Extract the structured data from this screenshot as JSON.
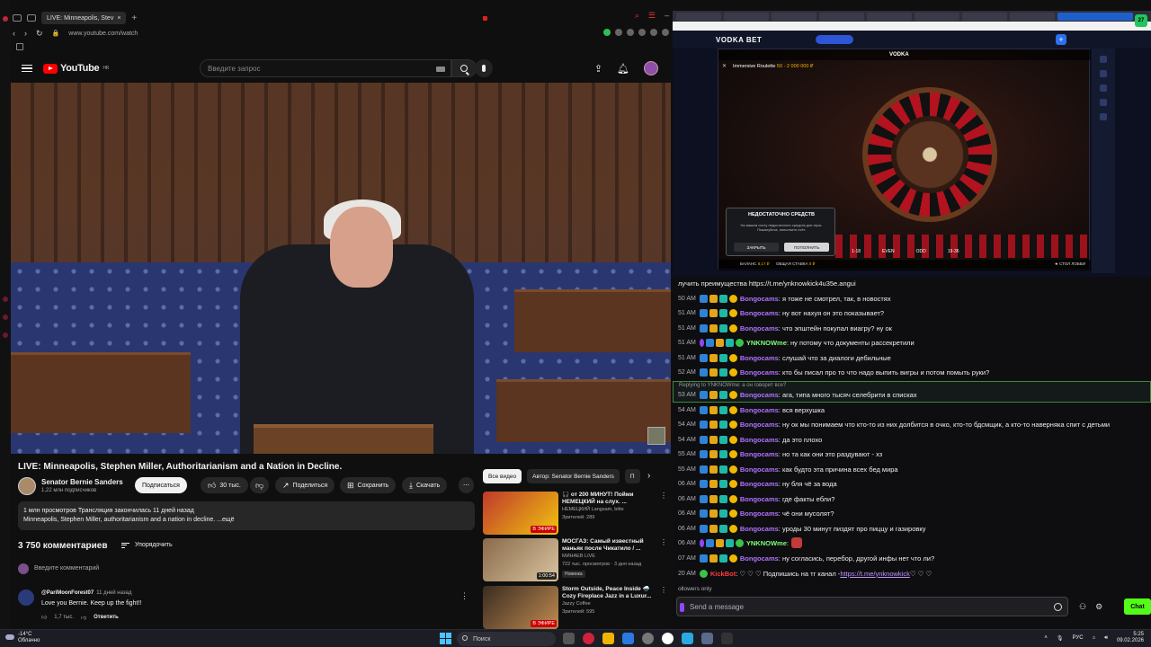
{
  "browser": {
    "tab_title": "LIVE: Minneapolis, Stev",
    "url": "www.youtube.com/watch"
  },
  "youtube": {
    "logo_text": "YouTube",
    "logo_region": "HR",
    "search_placeholder": "Введите запрос",
    "video_title": "LIVE: Minneapolis, Stephen Miller, Authoritarianism and a Nation in Decline.",
    "channel_name": "Senator Bernie Sanders",
    "channel_subs": "1,22 млн подписчиков",
    "subscribe_label": "Подписаться",
    "likes": "30 тыс.",
    "share_label": "Поделиться",
    "save_label": "Сохранить",
    "download_label": "Скачать",
    "desc_line1": "1 млн просмотров  Трансляция закончилась 11 дней назад",
    "desc_line2": "Minneapolis, Stephen Miller, authoritarianism and a nation in decline. ...ещё",
    "comments_count": "3 750 комментариев",
    "sort_label": "Упорядочить",
    "comment_placeholder": "Введите комментарий",
    "comment": {
      "author": "@PariMoonForest07",
      "time": "11 дней назад",
      "text": "Love you Bernie. Keep up the fight!!",
      "likes": "1,7 тыс.",
      "reply_label": "Ответить"
    },
    "chips": [
      "Все видео",
      "Автор: Senator Bernie Sanders",
      "П"
    ],
    "recs": [
      {
        "title": "🎧 от 200 МИНУТ! Пойми НЕМЕЦКИЙ на слух. ...",
        "channel": "НЕМЕЦКИЙ Langsam, bitte",
        "meta": "Зрителей: 289",
        "live": "В ЭФИРЕ",
        "color": "#c0392b"
      },
      {
        "title": "МОСГАЗ: Самый известный маньяк после Чикатило / ...",
        "channel": "МИНАЕВ LIVE",
        "meta": "722 тыс. просмотров · 3 дня назад",
        "badge": "Новинка",
        "duration": "1:00:54",
        "color": "#8a6a4a"
      },
      {
        "title": "Storm Outside, Peace Inside 🌧️ Cozy Fireplace Jazz in a Luxur...",
        "channel": "Jazzy Coffee",
        "meta": "Зрителей: 595",
        "live": "В ЭФИРЕ",
        "color": "#6b5a44"
      }
    ]
  },
  "casino": {
    "logo": "VODKA BET",
    "game_logo": "VODKA",
    "game_title": "Immersive Roulette",
    "game_limits": "50 - 2 000 000 ₽",
    "modal_title": "НЕДОСТАТОЧНО СРЕДСТВ",
    "modal_text": "На вашем счету недостаточно средств для игры. Пожалуйста, пополните счёт.",
    "modal_close": "ЗАКРЫТЬ",
    "modal_deposit": "ПОПОЛНИТЬ",
    "balance_label": "БАЛАНС",
    "balance": "8,17 ₽",
    "stake_label": "ОБЩАЯ СТАВКА",
    "stake": "0 ₽",
    "stol": "СТОЛ",
    "lobby": "ЛОББИ",
    "even": "EVEN",
    "odd": "ODD",
    "range_a": "1-18",
    "range_b": "19-36",
    "corner_badge": "27"
  },
  "chat": {
    "reply_label": "Replying to YNKNOWme: а он говорит все?",
    "top_partial": "лучить преимущества https://t.me/ynknowkick4u35e.angui",
    "messages": [
      {
        "ts": "50 AM",
        "user": "Bongocams",
        "text": ": я тоже не смотрел, так, в новостях",
        "type": "bongo"
      },
      {
        "ts": "51 AM",
        "user": "Bongocams",
        "text": ": ну вот нахуя он это показывает?",
        "type": "bongo"
      },
      {
        "ts": "51 AM",
        "user": "Bongocams",
        "text": ": что эпштейн покупал виагру? ну ок",
        "type": "bongo"
      },
      {
        "ts": "51 AM",
        "user": "YNKNOWme",
        "text": ": ну потому что документы рассекретили",
        "type": "ynk"
      },
      {
        "ts": "51 AM",
        "user": "Bongocams",
        "text": ": слушай что за диалоги дебильные",
        "type": "bongo"
      },
      {
        "ts": "52 AM",
        "user": "Bongocams",
        "text": ": кто бы писал про то что надо выпить вигры и потом помыть руки?",
        "type": "bongo"
      },
      {
        "ts": "53 AM",
        "user": "Bongocams",
        "text": ": ага, типа много тысяч селебрити в списках",
        "type": "bongo"
      },
      {
        "ts": "54 AM",
        "user": "Bongocams",
        "text": ": вся верхушка",
        "type": "bongo"
      },
      {
        "ts": "54 AM",
        "user": "Bongocams",
        "text": ": ну ок мы понимаем что кто-то из них долбится в очко, кто-то бдсмщик, а кто-то наверняка спит с детьми",
        "type": "bongo"
      },
      {
        "ts": "54 AM",
        "user": "Bongocams",
        "text": ": да это плохо",
        "type": "bongo"
      },
      {
        "ts": "55 AM",
        "user": "Bongocams",
        "text": ": но та как они это раздувают - хз",
        "type": "bongo"
      },
      {
        "ts": "55 AM",
        "user": "Bongocams",
        "text": ": как будто эта причина всех бед мира",
        "type": "bongo"
      },
      {
        "ts": "06 AM",
        "user": "Bongocams",
        "text": ": ну бля чё за вода",
        "type": "bongo"
      },
      {
        "ts": "06 AM",
        "user": "Bongocams",
        "text": ": где факты ебли?",
        "type": "bongo"
      },
      {
        "ts": "06 AM",
        "user": "Bongocams",
        "text": ": чё они мусолят?",
        "type": "bongo"
      },
      {
        "ts": "06 AM",
        "user": "Bongocams",
        "text": ": уроды 30 минут пиздят про пиццу и газировку",
        "type": "bongo"
      },
      {
        "ts": "06 AM",
        "user": "YNKNOWme",
        "text": ":",
        "type": "ynk"
      },
      {
        "ts": "07 AM",
        "user": "Bongocams",
        "text": ": ну согласись, перебор, другой инфы нет что ли?",
        "type": "bongo"
      },
      {
        "ts": "20 AM",
        "user": "KickBot",
        "text": ": ♡ ♡ ♡ Подпишись на тг канал - ",
        "link": "https://t.me/ynknowkick",
        "tail": " ♡ ♡ ♡",
        "type": "kick"
      }
    ],
    "followers_only": "ollowers only",
    "send_placeholder": "Send a message",
    "chat_button": "Chat"
  },
  "taskbar": {
    "temp": "-14°C",
    "weather": "Облачно",
    "search": "Поиск",
    "lang": "РУС",
    "time": "5:25",
    "date": "09.02.2026"
  }
}
